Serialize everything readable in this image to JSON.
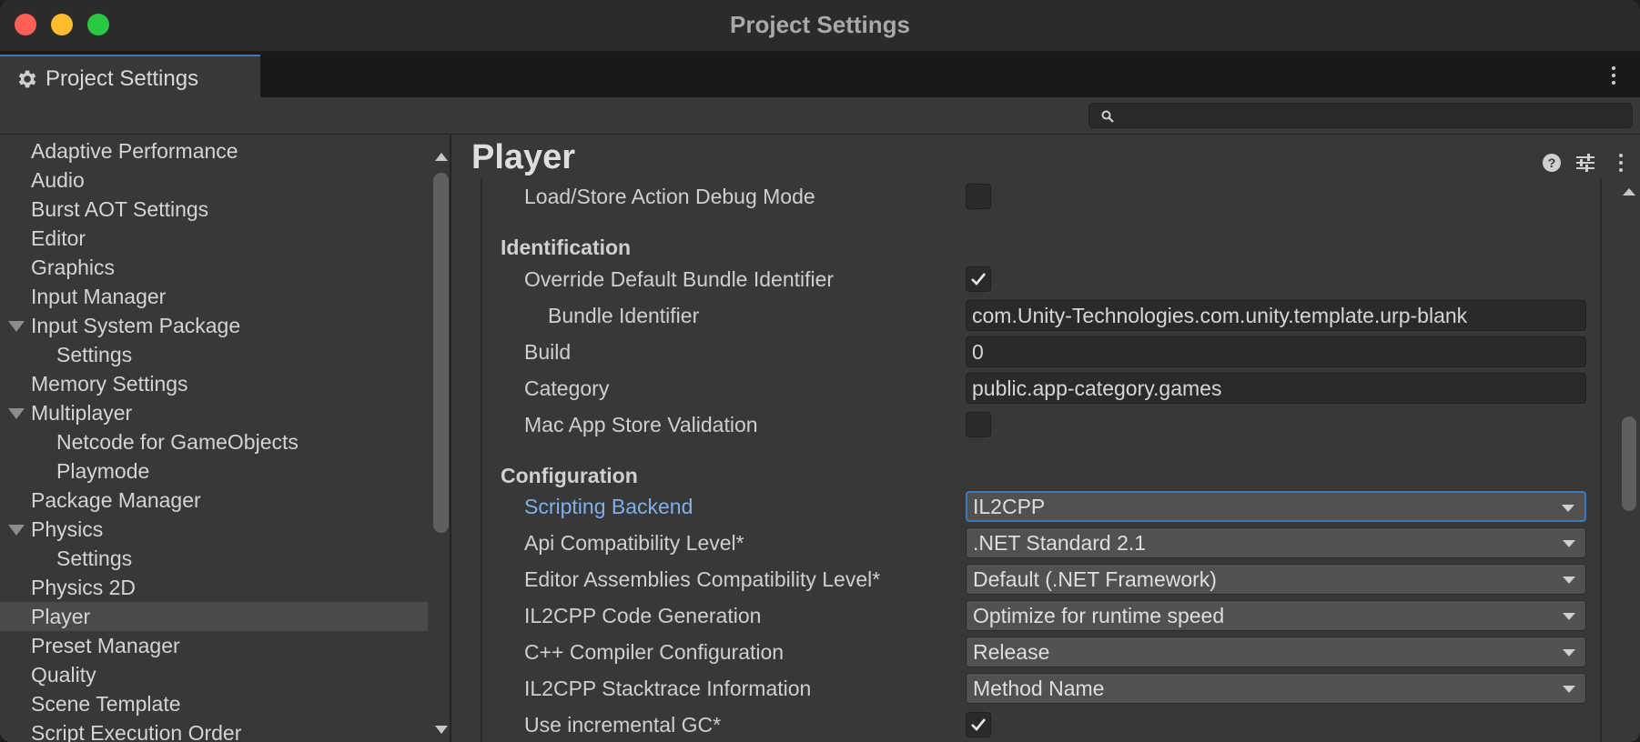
{
  "window": {
    "title": "Project Settings"
  },
  "tab": {
    "label": "Project Settings",
    "icon": "gear-icon"
  },
  "search": {
    "placeholder": "",
    "value": ""
  },
  "sidebar": {
    "items": [
      {
        "label": "Adaptive Performance",
        "indent": 0
      },
      {
        "label": "Audio",
        "indent": 0
      },
      {
        "label": "Burst AOT Settings",
        "indent": 0
      },
      {
        "label": "Editor",
        "indent": 0
      },
      {
        "label": "Graphics",
        "indent": 0
      },
      {
        "label": "Input Manager",
        "indent": 0
      },
      {
        "label": "Input System Package",
        "indent": 0,
        "expanded": true
      },
      {
        "label": "Settings",
        "indent": 1
      },
      {
        "label": "Memory Settings",
        "indent": 0
      },
      {
        "label": "Multiplayer",
        "indent": 0,
        "expanded": true
      },
      {
        "label": "Netcode for GameObjects",
        "indent": 1
      },
      {
        "label": "Playmode",
        "indent": 1
      },
      {
        "label": "Package Manager",
        "indent": 0
      },
      {
        "label": "Physics",
        "indent": 0,
        "expanded": true
      },
      {
        "label": "Settings",
        "indent": 1
      },
      {
        "label": "Physics 2D",
        "indent": 0
      },
      {
        "label": "Player",
        "indent": 0,
        "selected": true
      },
      {
        "label": "Preset Manager",
        "indent": 0
      },
      {
        "label": "Quality",
        "indent": 0
      },
      {
        "label": "Scene Template",
        "indent": 0
      },
      {
        "label": "Script Execution Order",
        "indent": 0
      }
    ]
  },
  "panel": {
    "title": "Player",
    "rows": [
      {
        "kind": "checkbox",
        "label": "Load/Store Action Debug Mode",
        "checked": false,
        "indent": 1
      },
      {
        "kind": "section",
        "label": "Identification"
      },
      {
        "kind": "checkbox",
        "label": "Override Default Bundle Identifier",
        "checked": true,
        "indent": 1
      },
      {
        "kind": "text",
        "label": "Bundle Identifier",
        "value": "com.Unity-Technologies.com.unity.template.urp-blank",
        "indent": 2
      },
      {
        "kind": "text",
        "label": "Build",
        "value": "0",
        "indent": 1
      },
      {
        "kind": "text",
        "label": "Category",
        "value": "public.app-category.games",
        "indent": 1
      },
      {
        "kind": "checkbox",
        "label": "Mac App Store Validation",
        "checked": false,
        "indent": 1
      },
      {
        "kind": "section",
        "label": "Configuration"
      },
      {
        "kind": "dropdown",
        "label": "Scripting Backend",
        "value": "IL2CPP",
        "indent": 1,
        "focused": true
      },
      {
        "kind": "dropdown",
        "label": "Api Compatibility Level*",
        "value": ".NET Standard 2.1",
        "indent": 1
      },
      {
        "kind": "dropdown",
        "label": "Editor Assemblies Compatibility Level*",
        "value": "Default (.NET Framework)",
        "indent": 1
      },
      {
        "kind": "dropdown",
        "label": "IL2CPP Code Generation",
        "value": "Optimize for runtime speed",
        "indent": 1
      },
      {
        "kind": "dropdown",
        "label": "C++ Compiler Configuration",
        "value": "Release",
        "indent": 1
      },
      {
        "kind": "dropdown",
        "label": "IL2CPP Stacktrace Information",
        "value": "Method Name",
        "indent": 1
      },
      {
        "kind": "checkbox",
        "label": "Use incremental GC*",
        "checked": true,
        "indent": 1
      }
    ]
  },
  "colors": {
    "window_bg": "#383838",
    "accent": "#3a79bb",
    "focused_label": "#7fb0ea",
    "traffic_close": "#fe5f57",
    "traffic_min": "#febc2e",
    "traffic_max": "#28c840"
  }
}
